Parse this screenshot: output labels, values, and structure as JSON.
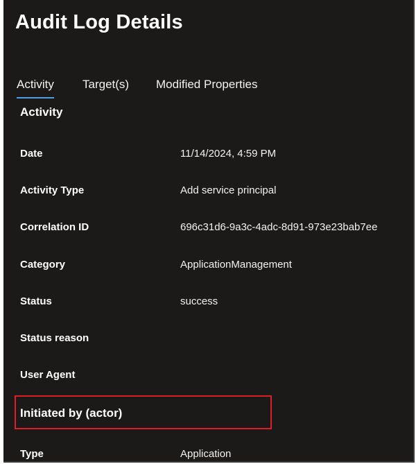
{
  "panel": {
    "title": "Audit Log Details"
  },
  "tabs": [
    {
      "label": "Activity",
      "active": true
    },
    {
      "label": "Target(s)",
      "active": false
    },
    {
      "label": "Modified Properties",
      "active": false
    }
  ],
  "activity": {
    "heading": "Activity",
    "rows": [
      {
        "label": "Date",
        "value": "11/14/2024, 4:59 PM"
      },
      {
        "label": "Activity Type",
        "value": "Add service principal"
      },
      {
        "label": "Correlation ID",
        "value": "696c31d6-9a3c-4adc-8d91-973e23bab7ee"
      },
      {
        "label": "Category",
        "value": "ApplicationManagement"
      },
      {
        "label": "Status",
        "value": "success"
      },
      {
        "label": "Status reason",
        "value": ""
      },
      {
        "label": "User Agent",
        "value": ""
      }
    ]
  },
  "actor": {
    "heading": "Initiated by (actor)",
    "rows": [
      {
        "label": "Type",
        "value": "Application"
      }
    ]
  },
  "colors": {
    "panel_background": "#1b1a19",
    "active_tab_underline": "#4f9de6",
    "highlight_border": "#e01e27"
  }
}
